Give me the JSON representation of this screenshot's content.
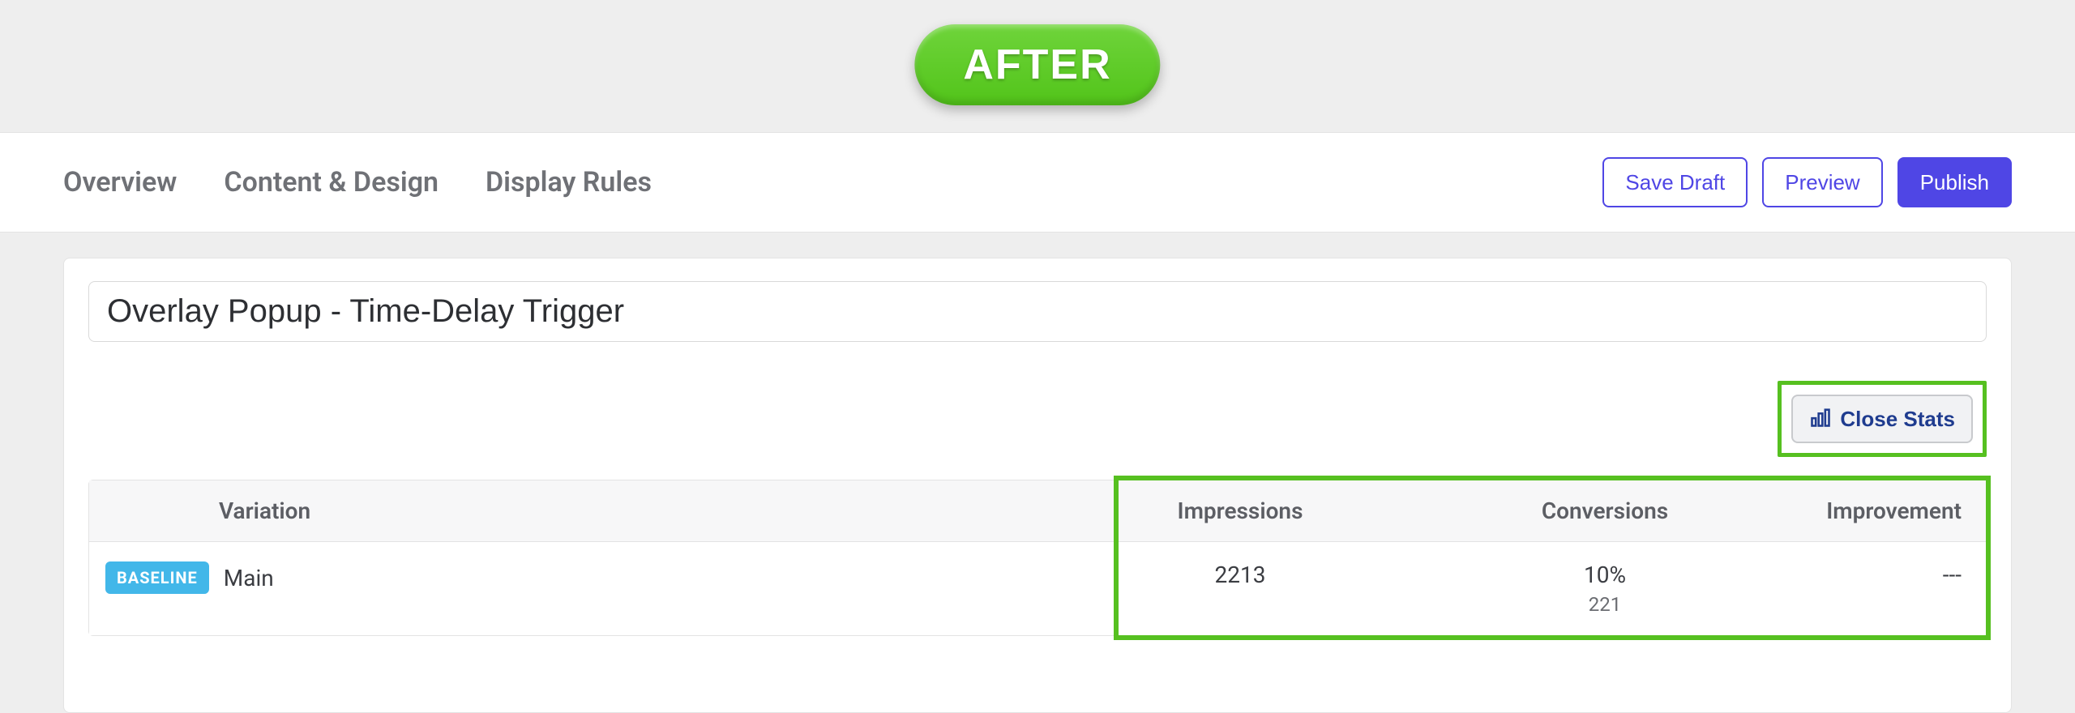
{
  "badge": {
    "after_label": "AFTER"
  },
  "tabs": {
    "overview": "Overview",
    "content_design": "Content & Design",
    "display_rules": "Display Rules"
  },
  "actions": {
    "save_draft": "Save Draft",
    "preview": "Preview",
    "publish": "Publish"
  },
  "title_value": "Overlay Popup - Time-Delay Trigger",
  "close_stats_label": "Close Stats",
  "table": {
    "headers": {
      "variation": "Variation",
      "impressions": "Impressions",
      "conversions": "Conversions",
      "improvement": "Improvement"
    },
    "row": {
      "baseline_badge": "BASELINE",
      "name": "Main",
      "impressions": "2213",
      "conversions_pct": "10%",
      "conversions_count": "221",
      "improvement": "---"
    }
  },
  "colors": {
    "highlight_green": "#56c020",
    "primary": "#4f46e5",
    "baseline_blue": "#42b7e9"
  }
}
